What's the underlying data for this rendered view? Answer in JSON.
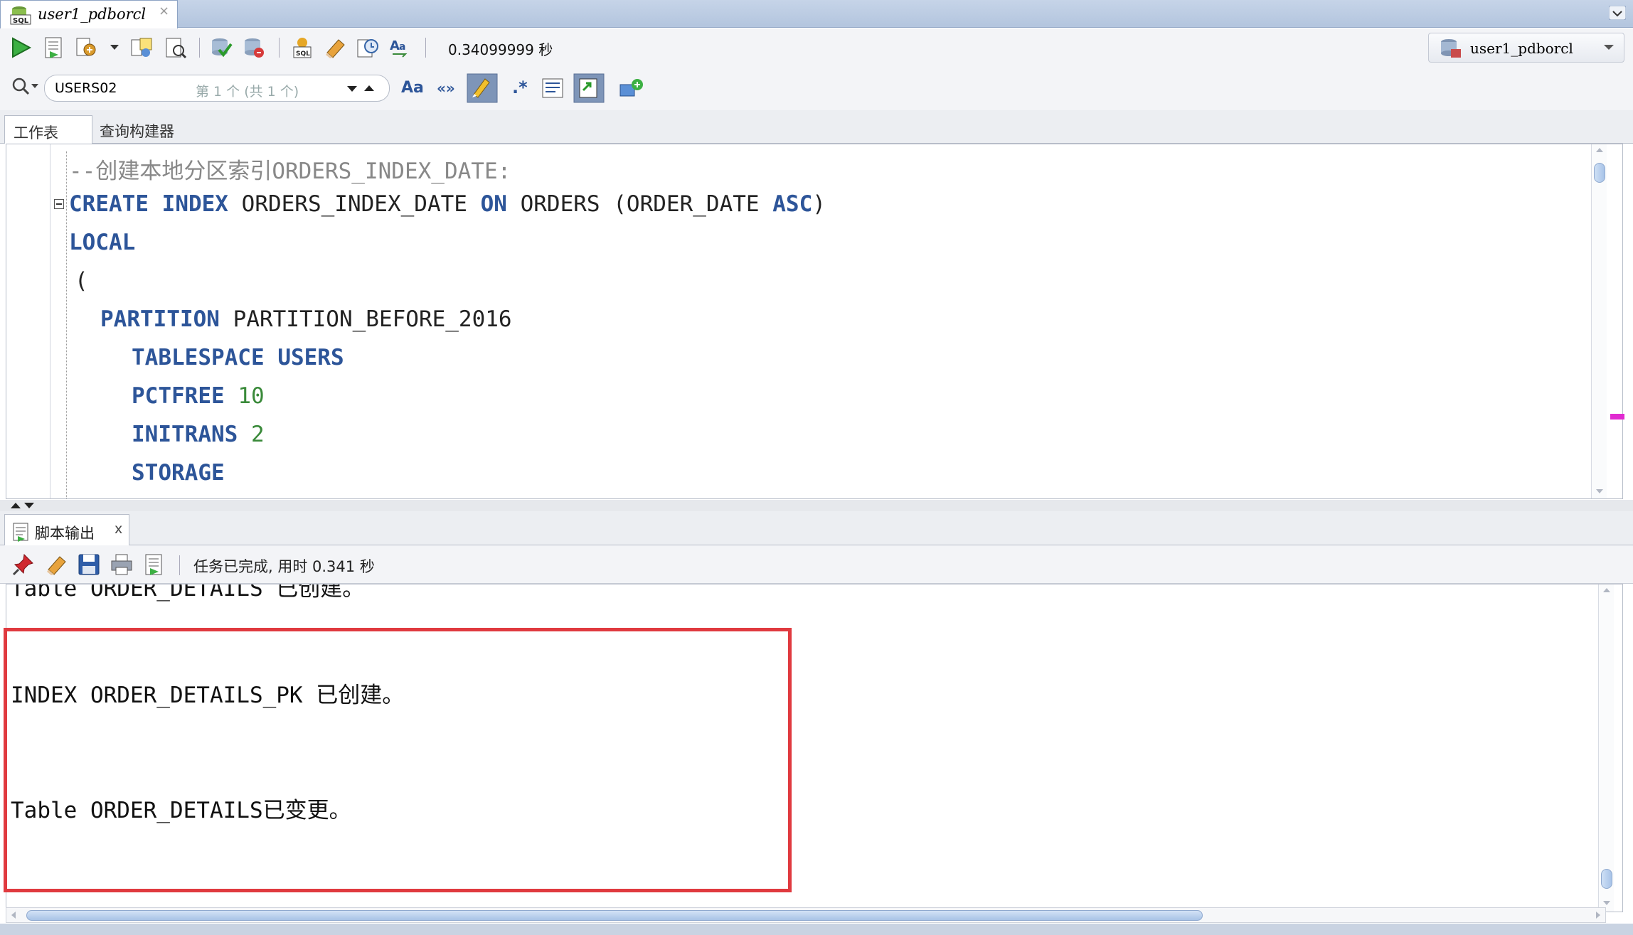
{
  "document_tab": {
    "title": "user1_pdborcl",
    "close": "×"
  },
  "toolbar": {
    "timing": "0.34099999 秒",
    "connection": "user1_pdborcl"
  },
  "search": {
    "value": "USERS02",
    "count": "第 1 个 (共 1 个)"
  },
  "format_buttons": {
    "match_case": "Aa",
    "quotes": "«»"
  },
  "editor_tabs": {
    "worksheet": "工作表",
    "query_builder": "查询构建器"
  },
  "code": {
    "line1": "--创建本地分区索引ORDERS_INDEX_DATE:",
    "kw_create": "CREATE",
    "kw_index": "INDEX",
    "name_index": "ORDERS_INDEX_DATE",
    "kw_on": "ON",
    "name_table": "ORDERS",
    "col_open": "(ORDER_DATE",
    "kw_asc": "ASC",
    "col_close": ")",
    "kw_local": "LOCAL",
    "paren": "(",
    "kw_partition": "PARTITION",
    "name_partition": "PARTITION_BEFORE_2016",
    "kw_tablespace": "TABLESPACE",
    "kw_users": "USERS",
    "kw_pctfree": "PCTFREE",
    "val_pctfree": "10",
    "kw_initrans": "INITRANS",
    "val_initrans": "2",
    "kw_storage": "STORAGE"
  },
  "output_panel": {
    "tab_label": "脚本输出",
    "tab_close": "x",
    "status": "任务已完成, 用时 0.341 秒",
    "lines": [
      "Table ORDER_DETAILS 已创建。",
      "INDEX ORDER_DETAILS_PK 已创建。",
      "Table ORDER_DETAILS已变更。"
    ]
  },
  "colors": {
    "keyword": "#2d5599",
    "number": "#3a8a3a",
    "comment": "#888888",
    "highlight": "#e03a3f"
  }
}
